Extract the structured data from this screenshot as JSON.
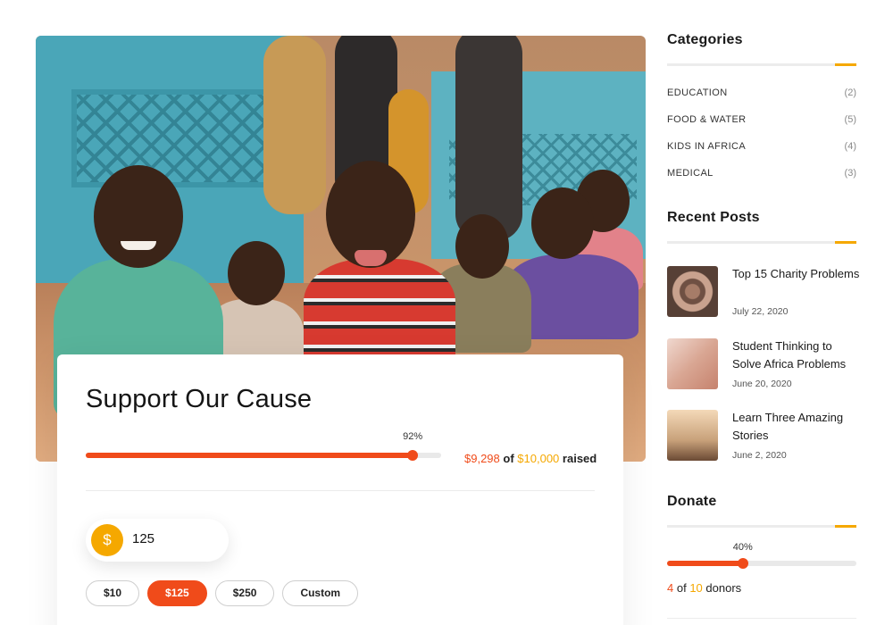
{
  "hero": {
    "image_description_icon": "children-photo-image"
  },
  "cause": {
    "title": "Support Our Cause",
    "progress_percent": 92,
    "progress_label": "92%",
    "raised_amount": "$9,298",
    "of_text": "of",
    "goal_amount": "$10,000",
    "raised_word": "raised",
    "currency_symbol": "$",
    "amount_value": "125",
    "presets": [
      {
        "label": "$10",
        "active": false
      },
      {
        "label": "$125",
        "active": true
      },
      {
        "label": "$250",
        "active": false
      },
      {
        "label": "Custom",
        "active": false
      }
    ],
    "colors": {
      "accent": "#f04b1a",
      "gold": "#f5a800"
    }
  },
  "sidebar": {
    "categories": {
      "title": "Categories",
      "items": [
        {
          "name": "EDUCATION",
          "count": "(2)"
        },
        {
          "name": "FOOD & WATER",
          "count": "(5)"
        },
        {
          "name": "KIDS IN AFRICA",
          "count": "(4)"
        },
        {
          "name": "MEDICAL",
          "count": "(3)"
        }
      ]
    },
    "recent_posts": {
      "title": "Recent Posts",
      "items": [
        {
          "title": "Top 15 Charity Problems",
          "date": "July 22, 2020"
        },
        {
          "title": "Student Thinking to Solve Africa Problems",
          "date": "June 20, 2020"
        },
        {
          "title": "Learn Three Amazing Stories",
          "date": "June 2, 2020"
        }
      ]
    },
    "donate": {
      "title": "Donate",
      "progress_percent": 40,
      "progress_label": "40%",
      "donors_current": "4",
      "of_text": "of",
      "donors_target": "10",
      "donors_word": "donors"
    }
  }
}
